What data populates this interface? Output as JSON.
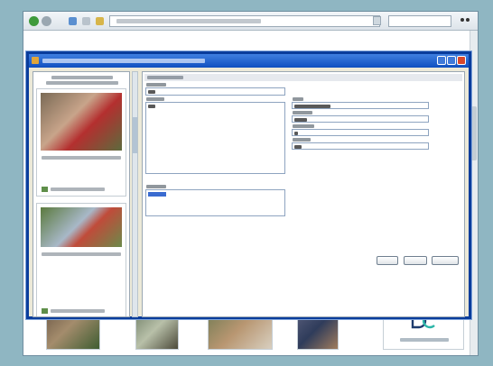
{
  "browser": {
    "toolbar": {
      "back_icon": "back-arrow-icon",
      "forward_icon": "forward-arrow-icon",
      "home_icon": "home-icon",
      "refresh_icon": "refresh-icon",
      "favorites_icon": "star-icon",
      "address_value": "",
      "search_value": ""
    }
  },
  "modal": {
    "title": "",
    "window_buttons": {
      "minimize": "minimize-icon",
      "maximize": "maximize-icon",
      "close": "close-icon"
    }
  },
  "form": {
    "buttons": [
      {
        "label": "",
        "icon": ""
      },
      {
        "label": "",
        "icon": ""
      },
      {
        "label": "",
        "icon": ""
      }
    ]
  },
  "logo": {
    "text": "DC"
  },
  "colors": {
    "titlebar_start": "#3f7fe0",
    "titlebar_end": "#0f4fc0",
    "close_button": "#d8482c",
    "background": "#8fb6c2"
  }
}
